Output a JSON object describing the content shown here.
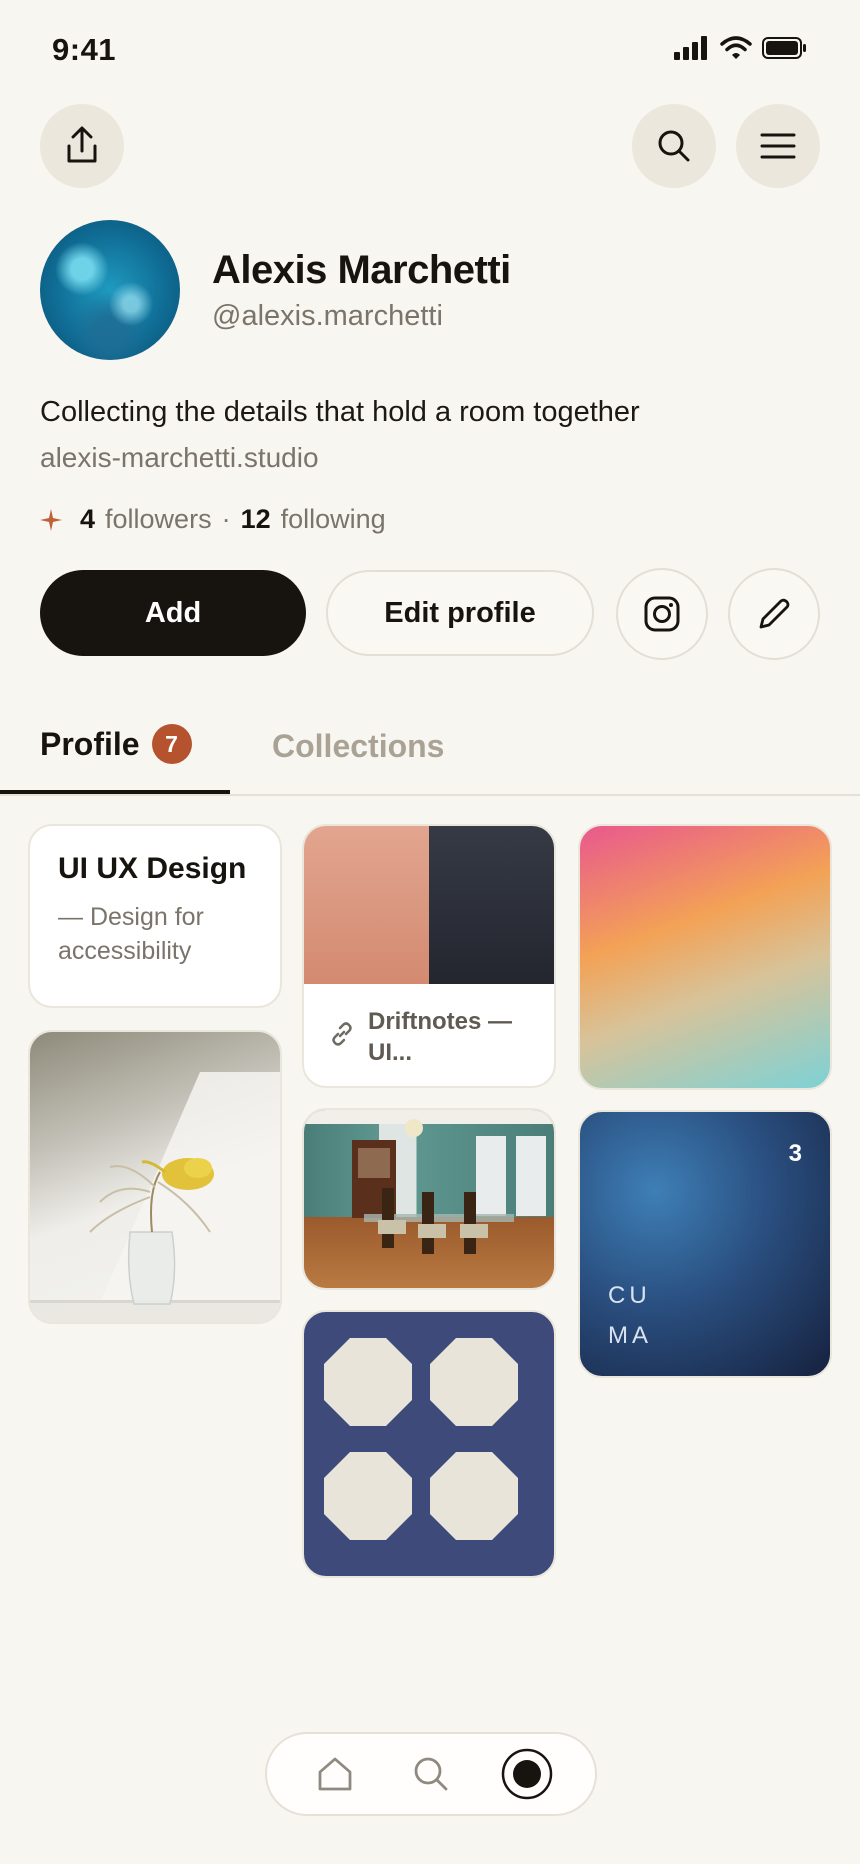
{
  "status_bar": {
    "time": "9:41"
  },
  "profile": {
    "name": "Alexis Marchetti",
    "handle": "@alexis.marchetti",
    "bio": "Collecting the details that hold a room together",
    "website": "alexis-marchetti.studio",
    "followers_count": "4",
    "followers_label": "followers",
    "separator": "·",
    "following_count": "12",
    "following_label": "following"
  },
  "actions": {
    "add_label": "Add",
    "edit_label": "Edit profile"
  },
  "tabs": {
    "profile_label": "Profile",
    "profile_badge": "7",
    "collections_label": "Collections"
  },
  "cards": {
    "text_card": {
      "title": "UI UX Design",
      "subtitle": "— Design for accessibility"
    },
    "link_card": {
      "label": "Driftnotes — UI..."
    },
    "blue_card": {
      "count": "3",
      "line1": "CU",
      "line2": "MA"
    }
  },
  "colors": {
    "background": "#f8f6f1",
    "accent": "#b4532e",
    "primary_button": "#17140f"
  },
  "icons": {
    "share": "share-icon",
    "search": "search-icon",
    "menu": "menu-icon",
    "instagram": "instagram-icon",
    "edit": "pencil-icon",
    "sparkle": "sparkle-icon",
    "link": "link-icon",
    "home": "home-icon",
    "profile": "profile-icon"
  }
}
